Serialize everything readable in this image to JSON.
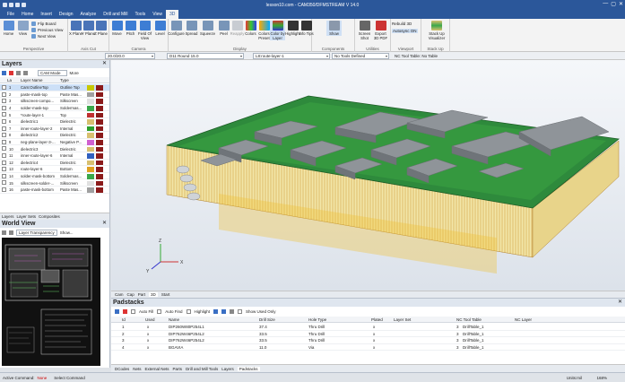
{
  "window": {
    "title": "lesson10.com - CAM350/DFMSTREAM V 14.0",
    "controls": [
      "—",
      "▢",
      "✕"
    ]
  },
  "menu": [
    "File",
    "Home",
    "Insert",
    "Design",
    "Analyze",
    "Drill and Mill",
    "Tools",
    "View",
    "3D"
  ],
  "menu_active": "3D",
  "ribbon": {
    "groups": [
      {
        "name": "Perspective",
        "buttons": [
          "Home",
          "View",
          "Flip Board",
          "Previous View",
          "Next View"
        ]
      },
      {
        "name": "Axis Cut",
        "buttons": [
          "X Plane",
          "Y Plane",
          "Z Plane"
        ]
      },
      {
        "name": "Camera",
        "buttons": [
          "Move",
          "Pitch",
          "Field Of View",
          "Level"
        ]
      },
      {
        "name": "Display",
        "buttons": [
          "Configure",
          "Spread",
          "Squeeze",
          "Peel",
          "Reapply",
          "Colors",
          "Colors Preset",
          "Color by Layer",
          "Highlight",
          "Info Tips"
        ]
      },
      {
        "name": "Components",
        "buttons": [
          "Show"
        ]
      },
      {
        "name": "Utilities",
        "buttons": [
          "Screen Shot",
          "Export 3D PDF"
        ]
      },
      {
        "name": "Viewport",
        "buttons": [
          "Rebuild 3D",
          "Autosync ON"
        ]
      },
      {
        "name": "Stack Up",
        "buttons": [
          "Stack Up Visualizer"
        ]
      }
    ]
  },
  "options_bar": {
    "units_value": "20.0/20.0",
    "dcode_value": "D11 Round 15.0",
    "layer_value": "L8:route-layer-1",
    "tool_value": "No Tools Defined",
    "nc_table_label": "NC Tool Table:",
    "nc_table_value": "No Table"
  },
  "layers_panel": {
    "title": "Layers",
    "mode": "CAM Mode",
    "more": "More",
    "columns": [
      "La",
      "Layer Name",
      "Type"
    ],
    "rows": [
      {
        "n": "1",
        "name": "Cam:OutlineTop",
        "type": "Outline Top",
        "color": "#c8c800",
        "sel": true
      },
      {
        "n": "2",
        "name": "paste-mask-top",
        "type": "Paste Mas...",
        "color": "#a0a0a0"
      },
      {
        "n": "3",
        "name": "silkscreen-compo...",
        "type": "Silkscreen",
        "color": "#e0e0e0"
      },
      {
        "n": "4",
        "name": "solder-mask-top",
        "type": "Soldermas...",
        "color": "#3aa84a"
      },
      {
        "n": "5",
        "name": "*route-layer-1",
        "type": "Top",
        "color": "#c03030"
      },
      {
        "n": "6",
        "name": "dielectric1",
        "type": "Dielectric",
        "color": "#d8c070"
      },
      {
        "n": "7",
        "name": "inner-route-layer-2",
        "type": "Internal",
        "color": "#2ca02c"
      },
      {
        "n": "8",
        "name": "dielectric2",
        "type": "Dielectric",
        "color": "#d8c070"
      },
      {
        "n": "9",
        "name": "neg-plane-layer-3-...",
        "type": "Negative P...",
        "color": "#d060d0"
      },
      {
        "n": "10",
        "name": "dielectric3",
        "type": "Dielectric",
        "color": "#d8c070"
      },
      {
        "n": "11",
        "name": "inner-route-layer-6",
        "type": "Internal",
        "color": "#3060c0"
      },
      {
        "n": "12",
        "name": "dielectric4",
        "type": "Dielectric",
        "color": "#d8c070"
      },
      {
        "n": "13",
        "name": "route-layer-6",
        "type": "Bottom",
        "color": "#e0a020"
      },
      {
        "n": "14",
        "name": "solder-mask-bottom",
        "type": "Soldermas...",
        "color": "#3aa84a"
      },
      {
        "n": "15",
        "name": "silkscreen-solder-...",
        "type": "Silkscreen",
        "color": "#e0e0e0"
      },
      {
        "n": "16",
        "name": "paste-mask-bottom",
        "type": "Paste Mas...",
        "color": "#a0a0a0"
      }
    ],
    "tabs": [
      "Layers",
      "Layer Sets",
      "Composites"
    ]
  },
  "world_view": {
    "title": "World View",
    "transparency": "Layer Transparency",
    "show": "Show..."
  },
  "view_tabs": [
    "Cam",
    "Cap",
    "Part",
    "3D",
    "Start"
  ],
  "padstacks": {
    "title": "Padstacks",
    "toolbar": [
      "Auto Fill",
      "Auto Find",
      "Highlight",
      "Show Used Only"
    ],
    "columns": [
      "Id",
      "Used",
      "Name",
      "Drill Size",
      "Hole Type",
      "Plated",
      "Layer Set",
      "NC Tool Table",
      "NC Layer"
    ],
    "rows": [
      {
        "id": "1",
        "used": "x",
        "name": "DIP260W80P254L1",
        "drill": "37.4",
        "hole": "Thru Drill",
        "plated": "x",
        "layerset": "",
        "table": "3",
        "tname": "DrillTable_1"
      },
      {
        "id": "2",
        "used": "x",
        "name": "DIP762W46P254L2",
        "drill": "33.5",
        "hole": "Thru Drill",
        "plated": "x",
        "layerset": "",
        "table": "3",
        "tname": "DrillTable_1"
      },
      {
        "id": "3",
        "used": "x",
        "name": "DIP762W46P254L2",
        "drill": "33.5",
        "hole": "Thru Drill",
        "plated": "x",
        "layerset": "",
        "table": "3",
        "tname": "DrillTable_1"
      },
      {
        "id": "4",
        "used": "x",
        "name": "BGAVIA",
        "drill": "11.0",
        "hole": "Via",
        "plated": "x",
        "layerset": "",
        "table": "3",
        "tname": "DrillTable_1"
      }
    ]
  },
  "bottom_tabs": [
    "DCodes",
    "Nets",
    "External Nets",
    "Parts",
    "Drill and Mill Tools",
    "Layers",
    "Padstacks"
  ],
  "status": {
    "active_label": "Active Command:",
    "active_value": "None",
    "select": "Select Command",
    "zoom": "168%",
    "units": "Units:mil"
  },
  "axes": {
    "x": "X",
    "y": "Y",
    "z": "Z"
  }
}
